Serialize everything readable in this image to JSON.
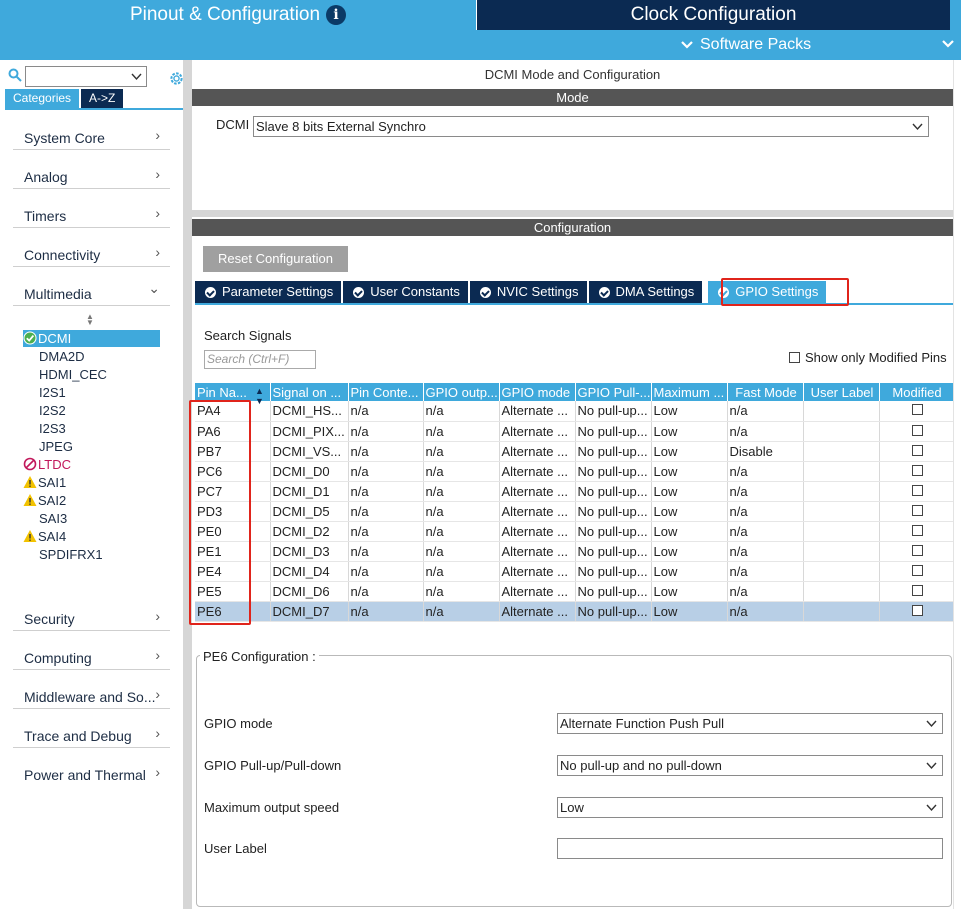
{
  "header": {
    "pinout_tab": "Pinout & Configuration",
    "info_icon": "i",
    "clock_tab": "Clock Configuration",
    "software_packs": "Software Packs"
  },
  "sidebar": {
    "tabs": [
      "Categories",
      "A->Z"
    ],
    "categories": [
      {
        "label": "System Core",
        "arrow": "›"
      },
      {
        "label": "Analog",
        "arrow": "›"
      },
      {
        "label": "Timers",
        "arrow": "›"
      },
      {
        "label": "Connectivity",
        "arrow": "›"
      },
      {
        "label": "Multimedia",
        "arrow": "⌄"
      }
    ],
    "multimedia_items": [
      {
        "label": "DCMI",
        "status": "ok",
        "selected": true
      },
      {
        "label": "DMA2D",
        "status": "none"
      },
      {
        "label": "HDMI_CEC",
        "status": "none"
      },
      {
        "label": "I2S1",
        "status": "none"
      },
      {
        "label": "I2S2",
        "status": "none"
      },
      {
        "label": "I2S3",
        "status": "none"
      },
      {
        "label": "JPEG",
        "status": "none"
      },
      {
        "label": "LTDC",
        "status": "disabled"
      },
      {
        "label": "SAI1",
        "status": "warning"
      },
      {
        "label": "SAI2",
        "status": "warning"
      },
      {
        "label": "SAI3",
        "status": "none"
      },
      {
        "label": "SAI4",
        "status": "warning"
      },
      {
        "label": "SPDIFRX1",
        "status": "none"
      }
    ],
    "categories_bottom": [
      {
        "label": "Security",
        "arrow": "›"
      },
      {
        "label": "Computing",
        "arrow": "›"
      },
      {
        "label": "Middleware and So...",
        "arrow": "›"
      },
      {
        "label": "Trace and Debug",
        "arrow": "›"
      },
      {
        "label": "Power and Thermal",
        "arrow": "›"
      }
    ]
  },
  "main": {
    "title": "DCMI Mode and Configuration",
    "mode_header": "Mode",
    "dcmi_label": "DCMI",
    "dcmi_value": "Slave 8 bits External Synchro",
    "config_header": "Configuration",
    "reset_button": "Reset Configuration",
    "tabs": [
      "Parameter Settings",
      "User Constants",
      "NVIC Settings",
      "DMA Settings",
      "GPIO Settings"
    ],
    "active_tab": "GPIO Settings",
    "search_label": "Search Signals",
    "search_placeholder": "Search (Ctrl+F)",
    "show_modified": "Show only Modified Pins",
    "table": {
      "columns": [
        "Pin Na...",
        "Signal on ...",
        "Pin Conte...",
        "GPIO outp...",
        "GPIO mode",
        "GPIO Pull-...",
        "Maximum ...",
        "Fast Mode",
        "User Label",
        "Modified"
      ],
      "rows": [
        [
          "PA4",
          "DCMI_HS...",
          "n/a",
          "n/a",
          "Alternate ...",
          "No pull-up...",
          "Low",
          "n/a",
          ""
        ],
        [
          "PA6",
          "DCMI_PIX...",
          "n/a",
          "n/a",
          "Alternate ...",
          "No pull-up...",
          "Low",
          "n/a",
          ""
        ],
        [
          "PB7",
          "DCMI_VS...",
          "n/a",
          "n/a",
          "Alternate ...",
          "No pull-up...",
          "Low",
          "Disable",
          ""
        ],
        [
          "PC6",
          "DCMI_D0",
          "n/a",
          "n/a",
          "Alternate ...",
          "No pull-up...",
          "Low",
          "n/a",
          ""
        ],
        [
          "PC7",
          "DCMI_D1",
          "n/a",
          "n/a",
          "Alternate ...",
          "No pull-up...",
          "Low",
          "n/a",
          ""
        ],
        [
          "PD3",
          "DCMI_D5",
          "n/a",
          "n/a",
          "Alternate ...",
          "No pull-up...",
          "Low",
          "n/a",
          ""
        ],
        [
          "PE0",
          "DCMI_D2",
          "n/a",
          "n/a",
          "Alternate ...",
          "No pull-up...",
          "Low",
          "n/a",
          ""
        ],
        [
          "PE1",
          "DCMI_D3",
          "n/a",
          "n/a",
          "Alternate ...",
          "No pull-up...",
          "Low",
          "n/a",
          ""
        ],
        [
          "PE4",
          "DCMI_D4",
          "n/a",
          "n/a",
          "Alternate ...",
          "No pull-up...",
          "Low",
          "n/a",
          ""
        ],
        [
          "PE5",
          "DCMI_D6",
          "n/a",
          "n/a",
          "Alternate ...",
          "No pull-up...",
          "Low",
          "n/a",
          ""
        ],
        [
          "PE6",
          "DCMI_D7",
          "n/a",
          "n/a",
          "Alternate ...",
          "No pull-up...",
          "Low",
          "n/a",
          ""
        ]
      ],
      "selected_row": 10
    },
    "pe6": {
      "title": "PE6 Configuration :",
      "gpio_mode_label": "GPIO mode",
      "gpio_mode_value": "Alternate Function Push Pull",
      "pull_label": "GPIO Pull-up/Pull-down",
      "pull_value": "No pull-up and no pull-down",
      "speed_label": "Maximum output speed",
      "speed_value": "Low",
      "user_label_label": "User Label",
      "user_label_value": ""
    }
  },
  "colors": {
    "accent": "#3fa9dc",
    "navy": "#0b2a52",
    "highlight_red": "#e0241b",
    "selected_row": "#b8cfe6"
  }
}
